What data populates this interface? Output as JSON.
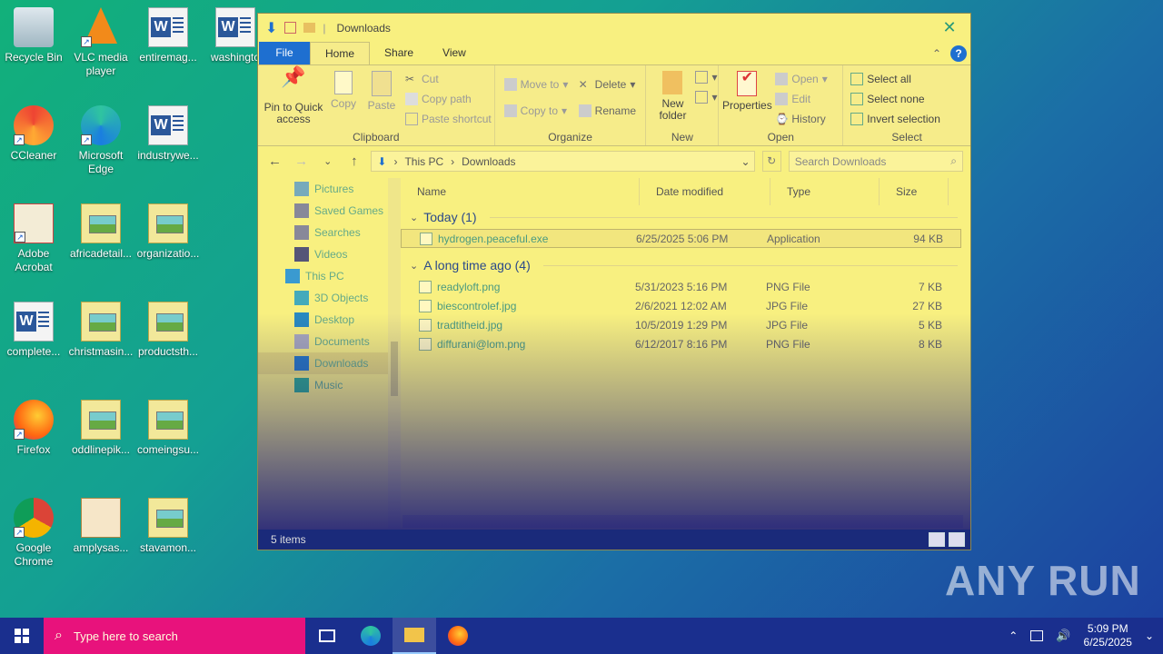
{
  "desktop": {
    "icons": [
      {
        "label": "Recycle Bin",
        "name": "recycle-bin-icon"
      },
      {
        "label": "VLC media player",
        "name": "vlc-icon"
      },
      {
        "label": "entiremag...",
        "name": "word-doc-icon"
      },
      {
        "label": "washingto",
        "name": "word-doc-icon"
      },
      {
        "label": "CCleaner",
        "name": "ccleaner-icon"
      },
      {
        "label": "Microsoft Edge",
        "name": "edge-icon"
      },
      {
        "label": "industrywe...",
        "name": "word-doc-icon"
      },
      {
        "label": "Adobe Acrobat",
        "name": "acrobat-icon"
      },
      {
        "label": "africadetail...",
        "name": "image-file-icon"
      },
      {
        "label": "organizatio...",
        "name": "image-file-icon"
      },
      {
        "label": "complete...",
        "name": "word-doc-icon"
      },
      {
        "label": "christmasin...",
        "name": "image-file-icon"
      },
      {
        "label": "productsth...",
        "name": "image-file-icon"
      },
      {
        "label": "Firefox",
        "name": "firefox-icon"
      },
      {
        "label": "oddlinepik...",
        "name": "image-file-icon"
      },
      {
        "label": "comeingsu...",
        "name": "image-file-icon"
      },
      {
        "label": "Google Chrome",
        "name": "chrome-icon"
      },
      {
        "label": "amplysas...",
        "name": "rtf-file-icon"
      },
      {
        "label": "stavamon...",
        "name": "image-file-icon"
      }
    ]
  },
  "explorer": {
    "title": "Downloads",
    "tabs": [
      "File",
      "Home",
      "Share",
      "View"
    ],
    "ribbon": {
      "clipboard": {
        "name": "Clipboard",
        "pin": "Pin to Quick access",
        "copy": "Copy",
        "paste": "Paste",
        "cut": "Cut",
        "copy_path": "Copy path",
        "paste_shortcut": "Paste shortcut"
      },
      "organize": {
        "name": "Organize",
        "move_to": "Move to",
        "copy_to": "Copy to",
        "delete": "Delete",
        "rename": "Rename"
      },
      "new": {
        "name": "New",
        "new_folder": "New folder"
      },
      "open": {
        "name": "Open",
        "properties": "Properties",
        "open": "Open",
        "edit": "Edit",
        "history": "History"
      },
      "select": {
        "name": "Select",
        "select_all": "Select all",
        "select_none": "Select none",
        "invert": "Invert selection"
      }
    },
    "address": {
      "parts": [
        "This PC",
        "Downloads"
      ]
    },
    "search": {
      "placeholder": "Search Downloads"
    },
    "nav": [
      {
        "label": "Pictures",
        "icon": "pictures-icon"
      },
      {
        "label": "Saved Games",
        "icon": "saved-games-icon"
      },
      {
        "label": "Searches",
        "icon": "searches-icon"
      },
      {
        "label": "Videos",
        "icon": "videos-icon"
      },
      {
        "label": "This PC",
        "icon": "computer-icon"
      },
      {
        "label": "3D Objects",
        "icon": "3d-objects-icon"
      },
      {
        "label": "Desktop",
        "icon": "desktop-icon"
      },
      {
        "label": "Documents",
        "icon": "documents-icon"
      },
      {
        "label": "Downloads",
        "icon": "downloads-icon",
        "selected": true
      },
      {
        "label": "Music",
        "icon": "music-icon"
      }
    ],
    "columns": [
      "Name",
      "Date modified",
      "Type",
      "Size"
    ],
    "groups": [
      {
        "label": "Today (1)",
        "files": [
          {
            "name": "hydrogen.peaceful.exe",
            "date": "6/25/2025 5:06 PM",
            "type": "Application",
            "size": "94 KB",
            "selected": true
          }
        ]
      },
      {
        "label": "A long time ago (4)",
        "files": [
          {
            "name": "readyloft.png",
            "date": "5/31/2023 5:16 PM",
            "type": "PNG File",
            "size": "7 KB"
          },
          {
            "name": "biescontrolef.jpg",
            "date": "2/6/2021 12:02 AM",
            "type": "JPG File",
            "size": "27 KB"
          },
          {
            "name": "tradtitheid.jpg",
            "date": "10/5/2019 1:29 PM",
            "type": "JPG File",
            "size": "5 KB"
          },
          {
            "name": "diffurani@lom.png",
            "date": "6/12/2017 8:16 PM",
            "type": "PNG File",
            "size": "8 KB"
          }
        ]
      }
    ],
    "status": "5 items"
  },
  "taskbar": {
    "search_placeholder": "Type here to search",
    "time": "5:09 PM",
    "date": "6/25/2025"
  },
  "watermark": "ANY RUN"
}
